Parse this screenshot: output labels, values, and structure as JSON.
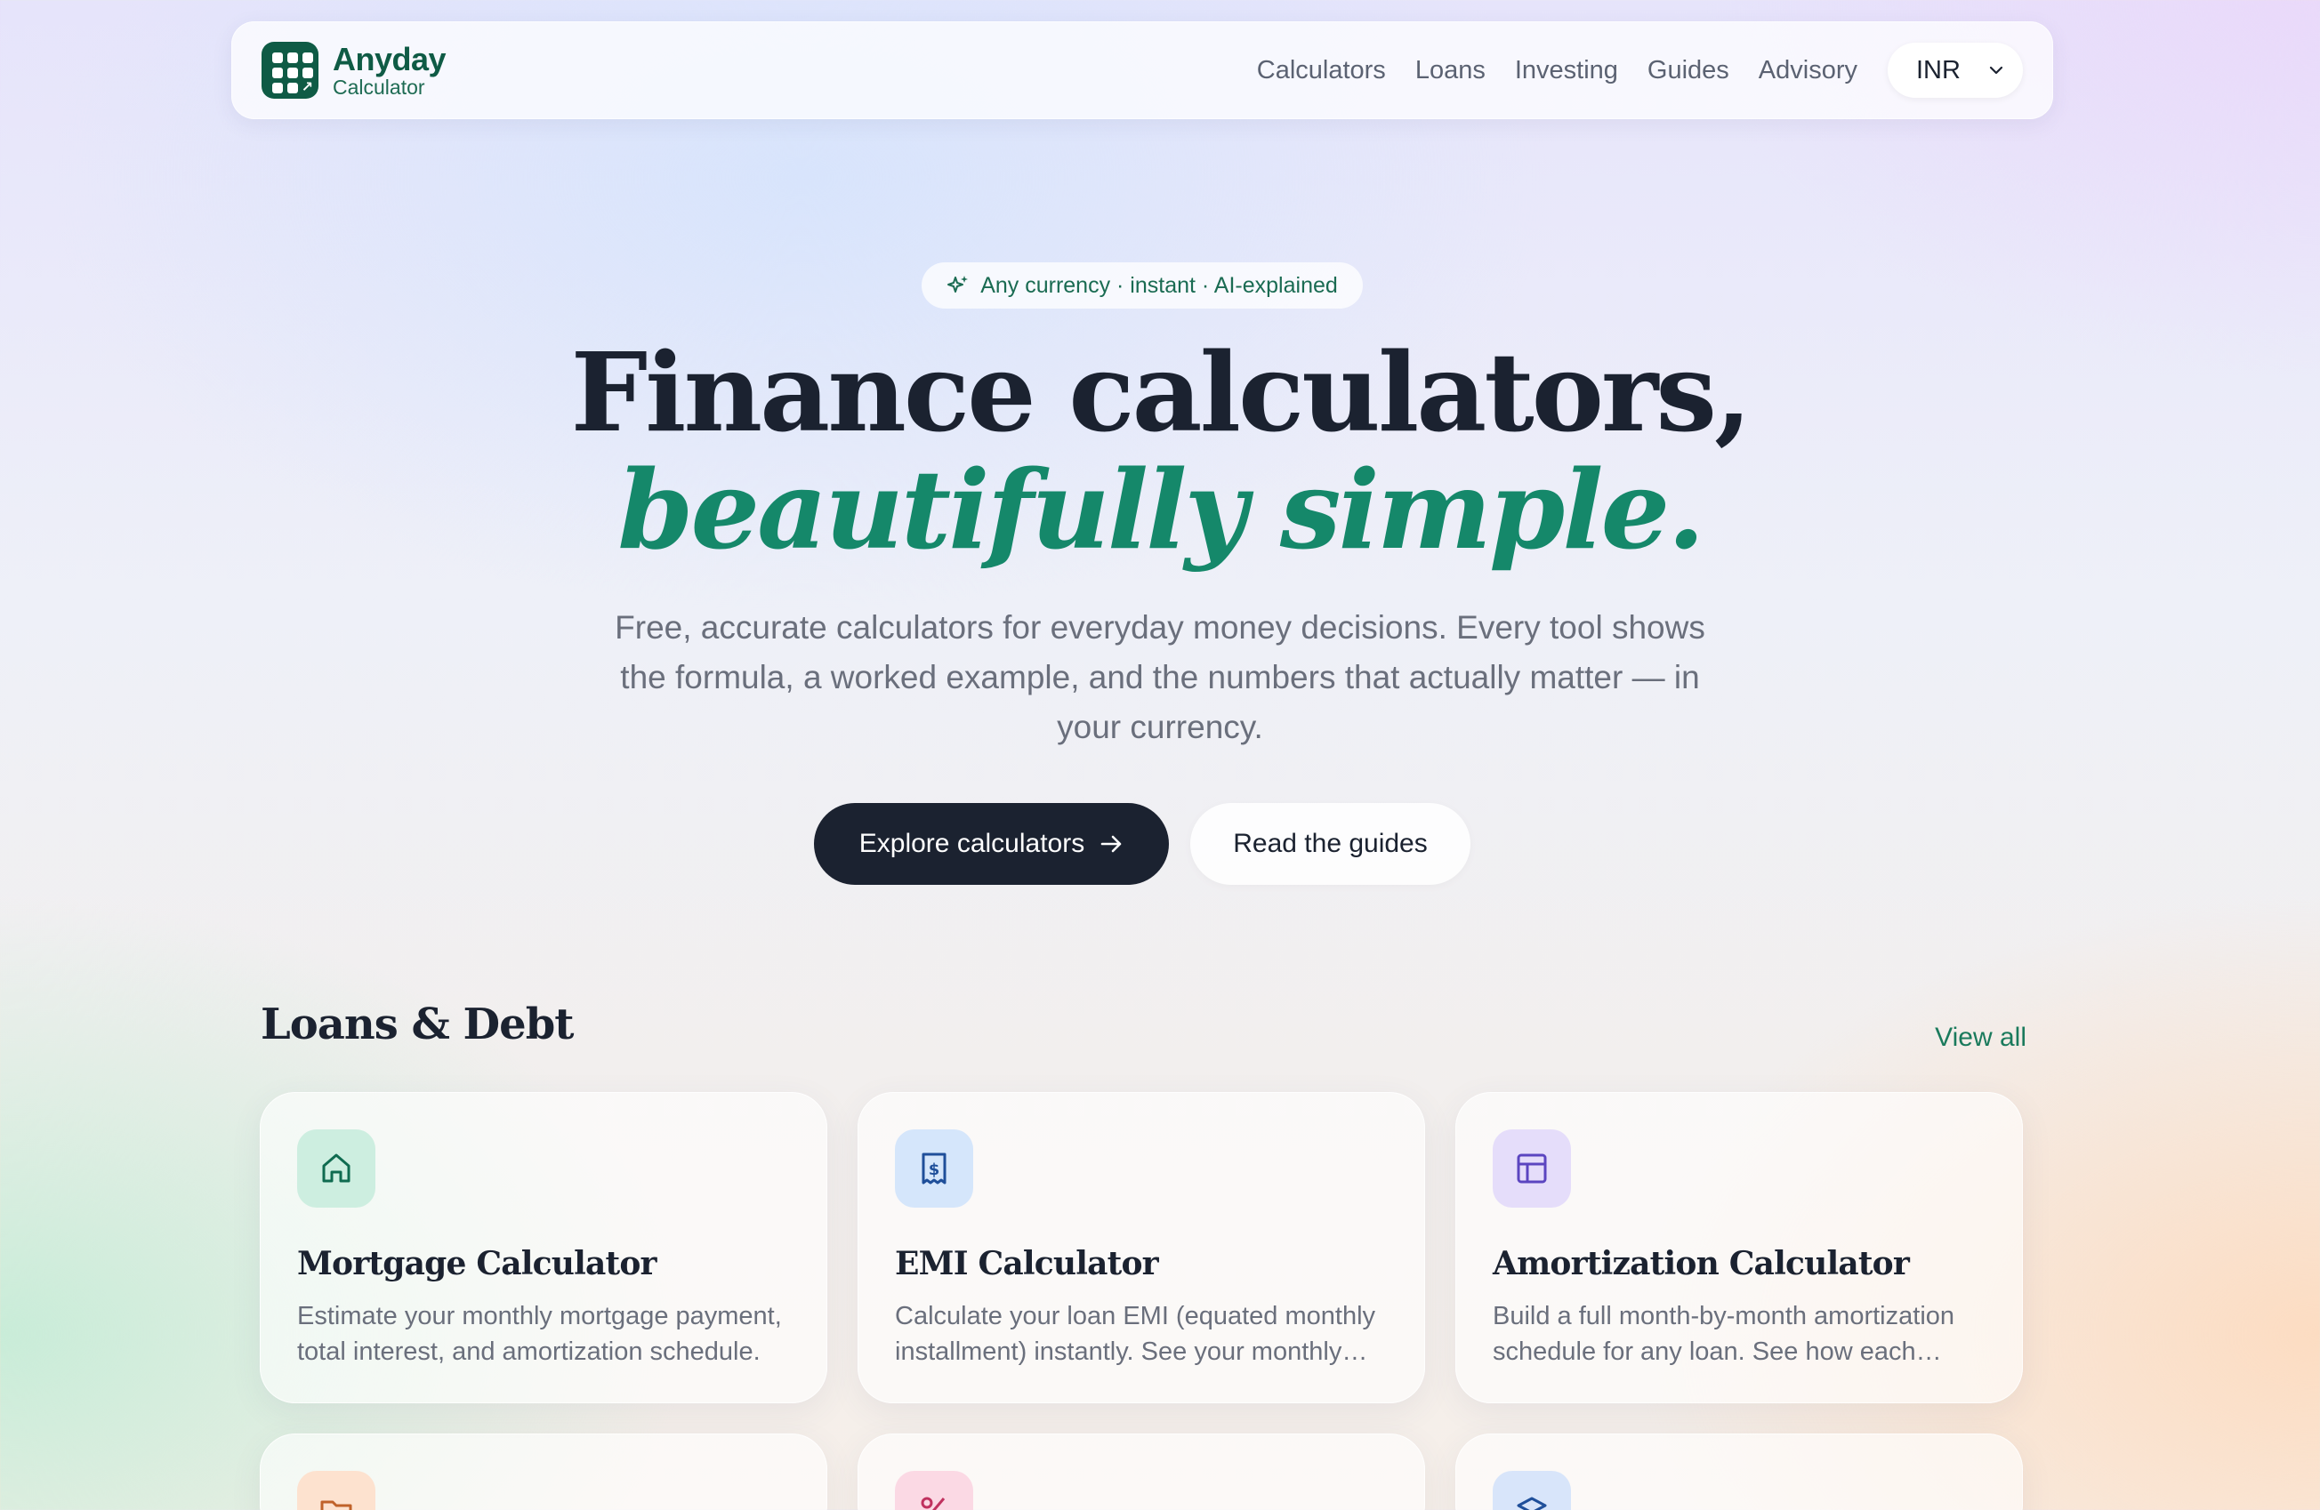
{
  "nav": {
    "brand_name": "Anyday",
    "brand_sub": "Calculator",
    "links": [
      "Calculators",
      "Loans",
      "Investing",
      "Guides",
      "Advisory"
    ],
    "currency": "INR"
  },
  "hero": {
    "pill": "Any currency · instant · AI-explained",
    "title_line1": "Finance calculators,",
    "title_line2": "beautifully simple.",
    "lead": "Free, accurate calculators for everyday money decisions. Every tool shows the formula, a worked example, and the numbers that actually matter — in your currency.",
    "primary_button": "Explore calculators",
    "secondary_button": "Read the guides"
  },
  "section": {
    "title": "Loans & Debt",
    "view_all": "View all",
    "cards": [
      {
        "title": "Mortgage Calculator",
        "desc": "Estimate your monthly mortgage payment, total interest, and amortization schedule.",
        "icon": "home-icon"
      },
      {
        "title": "EMI Calculator",
        "desc": "Calculate your loan EMI (equated monthly installment) instantly. See your monthly breakdown.",
        "icon": "receipt-icon"
      },
      {
        "title": "Amortization Calculator",
        "desc": "Build a full month-by-month amortization schedule for any loan. See how each payment splits.",
        "icon": "table-icon"
      }
    ],
    "row2_icons": [
      "folder-icon",
      "percent-icon",
      "stack-icon"
    ]
  },
  "colors": {
    "brand": "#0f5b45",
    "accent": "#15886a",
    "dark": "#1b2230"
  }
}
